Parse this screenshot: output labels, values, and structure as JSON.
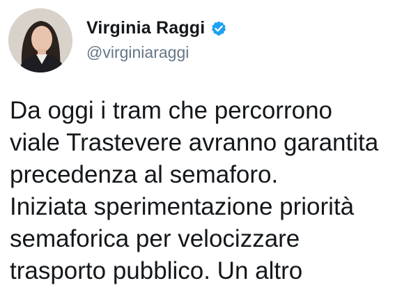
{
  "user": {
    "display_name": "Virginia Raggi",
    "handle": "@virginiaraggi",
    "verified": true,
    "verified_icon": "verified-badge-icon",
    "verified_color": "#1da1f2"
  },
  "tweet": {
    "lines": [
      "Da oggi i tram che percorrono",
      "viale Trastevere avranno garantita",
      "precedenza al semaforo.",
      "Iniziata sperimentazione priorità",
      "semaforica per velocizzare",
      "trasporto pubblico. Un altro"
    ]
  },
  "colors": {
    "text": "#14171a",
    "handle": "#657786",
    "background": "#ffffff"
  }
}
